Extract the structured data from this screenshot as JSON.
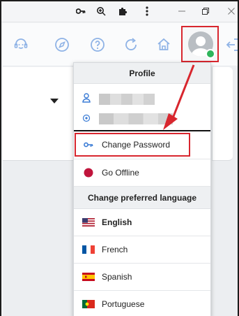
{
  "menu": {
    "profile_header": "Profile",
    "change_password_label": "Change Password",
    "go_offline_label": "Go Offline",
    "language_header": "Change preferred language",
    "languages": [
      {
        "label": "English",
        "flag": "us-flag-icon",
        "selected": true
      },
      {
        "label": "French",
        "flag": "fr-flag-icon",
        "selected": false
      },
      {
        "label": "Spanish",
        "flag": "es-flag-icon",
        "selected": false
      },
      {
        "label": "Portuguese",
        "flag": "pt-flag-icon",
        "selected": false
      }
    ]
  },
  "colors": {
    "accent_blue": "#3a7bd5",
    "highlight_red": "#d8262e",
    "status_green": "#2fb55b",
    "offline_red": "#c0143c",
    "toolbar_icon": "#8fb3e6"
  },
  "icons": {
    "toolbar": [
      "support-agent-icon",
      "compass-icon",
      "help-circle-icon",
      "refresh-icon",
      "home-icon",
      "avatar-icon",
      "logout-icon"
    ],
    "window": [
      "key-icon",
      "zoom-icon",
      "extension-puzzle-icon",
      "kebab-menu-icon",
      "minimize-icon",
      "restore-icon",
      "close-icon"
    ]
  }
}
